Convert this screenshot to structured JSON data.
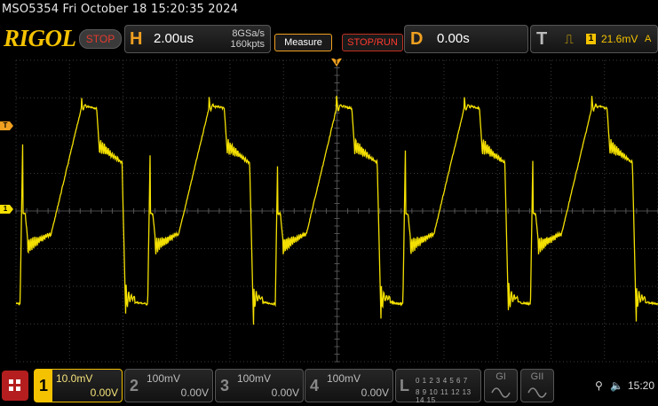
{
  "title_line": "MSO5354  Fri October 18 15:20:35 2024",
  "toolbar": {
    "logo": "RIGOL",
    "run_state": "STOP",
    "horizontal": {
      "letter": "H",
      "scale": "2.00us",
      "sample_rate": "8GSa/s",
      "memory_depth": "160kpts"
    },
    "measure_label": "Measure",
    "stop_run_label": "STOP/RUN",
    "delay": {
      "letter": "D",
      "value": "0.00s"
    },
    "trigger": {
      "letter": "T",
      "channel": "1",
      "level": "21.6mV",
      "mode": "A"
    }
  },
  "waveform": {
    "color": "#f4e000",
    "trigger_marker": "T",
    "ground_marker": "1",
    "top_marker": "T",
    "period_us": 4.77,
    "time_per_div_us": 2.0,
    "divisions": {
      "x": 12,
      "y": 8
    }
  },
  "channels": [
    {
      "num": "1",
      "scale": "10.0mV",
      "offset": "0.00V",
      "active": true
    },
    {
      "num": "2",
      "scale": "100mV",
      "offset": "0.00V",
      "active": false
    },
    {
      "num": "3",
      "scale": "100mV",
      "offset": "0.00V",
      "active": false
    },
    {
      "num": "4",
      "scale": "100mV",
      "offset": "0.00V",
      "active": false
    }
  ],
  "logic": {
    "letter": "L",
    "digits_row1": "0 1 2 3  4 5 6 7",
    "digits_row2": "8 9 10 11 12 13 14 15"
  },
  "generators": [
    {
      "label": "GI"
    },
    {
      "label": "GII"
    }
  ],
  "status": {
    "clock": "15:20"
  }
}
